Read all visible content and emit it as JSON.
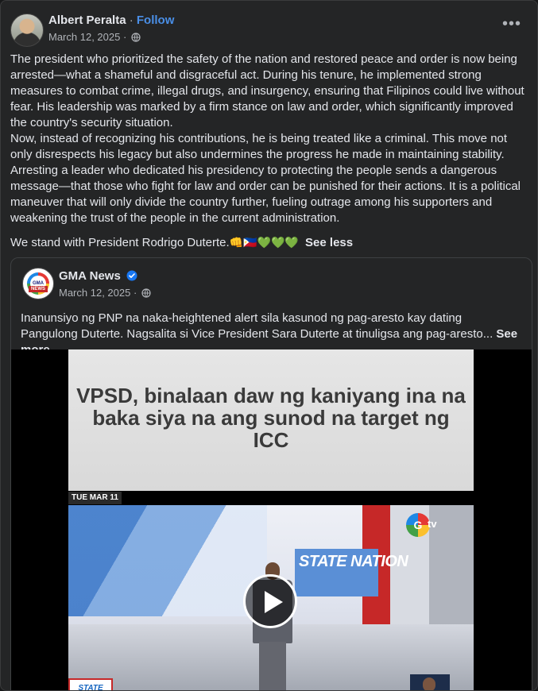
{
  "post": {
    "author": "Albert Peralta",
    "separator": "·",
    "follow_label": "Follow",
    "date": "March 12, 2025 ·",
    "more_label": "•••",
    "paragraphs": [
      "The president who prioritized the safety of the nation and restored peace and order is now being arrested—what a shameful and disgraceful act. During his tenure, he implemented strong measures to combat crime, illegal drugs, and insurgency, ensuring that Filipinos could live without fear. His leadership was marked by a firm stance on law and order, which significantly improved the country's security situation.",
      "Now, instead of recognizing his contributions, he is being treated like a criminal. This move not only disrespects his legacy but also undermines the progress he made in maintaining stability. Arresting a leader who dedicated his presidency to protecting the people sends a dangerous message—that those who fight for law and order can be punished for their actions. It is a political maneuver that will only divide the country further, fueling outrage among his supporters and weakening the trust of the people in the current administration."
    ],
    "closing": "We stand with President Rodrigo Duterte.",
    "emojis": "👊🇵🇭💚💚💚",
    "see_less": "See less"
  },
  "shared": {
    "page_name": "GMA News",
    "logo_text": "GMA",
    "logo_sub": "NEWS",
    "date": "March 12, 2025 ·",
    "text": "Inanunsiyo ng PNP na naka-heightened alert sila kasunod ng pag-aresto kay dating Pangulong Duterte. Nagsalita si Vice President Sara Duterte at tinuligsa ang pag-aresto...",
    "see_more": "See more"
  },
  "video": {
    "headline": "VPSD, binalaan daw ng kaniyang ina na baka siya na ang sunod na target ng ICC",
    "date_tag": "TUE MAR 11",
    "show_title": "STATE NATION",
    "channel_mark": "G",
    "channel_suffix": "tv",
    "corner_text": "STATE"
  },
  "colors": {
    "background": "#242526",
    "link_blue": "#4a8fe7",
    "verified_blue": "#1877f2",
    "text": "#e4e6eb",
    "muted": "#b0b3b8"
  }
}
